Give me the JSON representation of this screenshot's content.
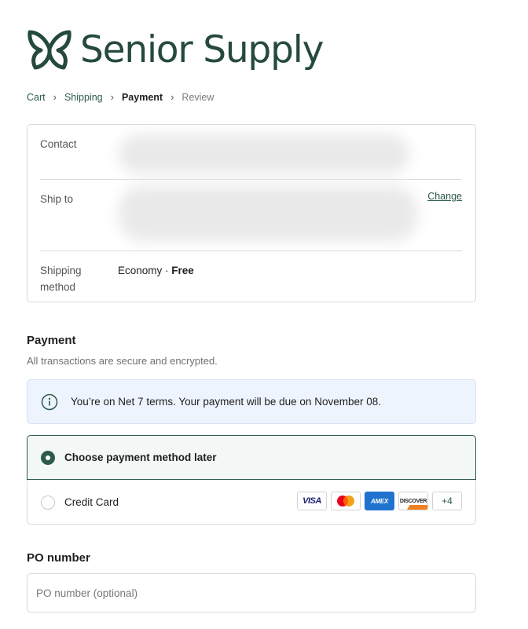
{
  "brand": {
    "name": "Senior Supply",
    "color": "#254a3c",
    "icon": "butterfly-icon"
  },
  "breadcrumb": [
    {
      "label": "Cart",
      "state": "done"
    },
    {
      "label": "Shipping",
      "state": "done"
    },
    {
      "label": "Payment",
      "state": "current"
    },
    {
      "label": "Review",
      "state": "future"
    }
  ],
  "review": {
    "contact": {
      "label": "Contact"
    },
    "ship_to": {
      "label": "Ship to",
      "change_label": "Change"
    },
    "shipping_method": {
      "label": "Shipping method",
      "value_prefix": "Economy · ",
      "value_price": "Free"
    }
  },
  "payment": {
    "title": "Payment",
    "subtitle": "All transactions are secure and encrypted.",
    "notice": "You’re on Net 7 terms. Your payment will be due on November 08.",
    "options": [
      {
        "label": "Choose payment method later",
        "selected": true
      },
      {
        "label": "Credit Card",
        "selected": false
      }
    ],
    "cards": {
      "visa": "VISA",
      "amex": "AMEX",
      "discover": "DISCOVER",
      "more": "+4"
    }
  },
  "po": {
    "title": "PO number",
    "placeholder": "PO number (optional)",
    "value": ""
  },
  "colors": {
    "accent": "#2c5b4a",
    "info_bg": "#eef4fd",
    "selected_bg": "#f3f8f6"
  }
}
